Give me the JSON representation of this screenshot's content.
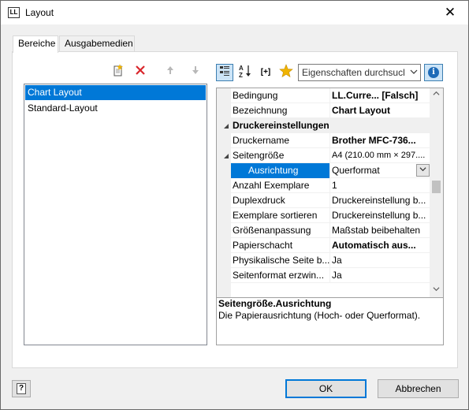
{
  "window": {
    "title": "Layout",
    "icon_text": "LL",
    "close_glyph": "✕"
  },
  "tabs": [
    {
      "label": "Bereiche",
      "active": true
    },
    {
      "label": "Ausgabemedien",
      "active": false
    }
  ],
  "left_toolbar": {
    "icons": [
      "new-item-icon",
      "delete-icon",
      "move-up-icon",
      "move-down-icon"
    ],
    "delete_color": "#d9262c"
  },
  "layout_list": [
    {
      "label": "Chart Layout",
      "selected": true
    },
    {
      "label": "Standard-Layout",
      "selected": false
    }
  ],
  "right_toolbar": {
    "icons": [
      "categorized-view-icon",
      "alphabetical-sort-icon",
      "expand-collapse-icon",
      "favorites-star-icon",
      "info-icon"
    ],
    "expand_label": "[+]",
    "search_placeholder": "Eigenschaften durchsuchen",
    "info_glyph": "i"
  },
  "properties": [
    {
      "name": "Bedingung",
      "value": "LL.Curre... [Falsch]",
      "bold": true,
      "type": "prop"
    },
    {
      "name": "Bezeichnung",
      "value": "Chart Layout",
      "bold": true,
      "type": "prop"
    },
    {
      "name": "Druckereinstellungen",
      "value": "",
      "bold": true,
      "type": "category"
    },
    {
      "name": "Druckername",
      "value": "Brother MFC-736...",
      "bold": true,
      "type": "prop"
    },
    {
      "name": "Seitengröße",
      "value": "A4 (210.00 mm × 297....",
      "bold": false,
      "type": "expandable"
    },
    {
      "name": "Ausrichtung",
      "value": "Querformat",
      "bold": false,
      "type": "selected"
    },
    {
      "name": "Anzahl Exemplare",
      "value": "1",
      "bold": false,
      "type": "prop"
    },
    {
      "name": "Duplexdruck",
      "value": "Druckereinstellung b...",
      "bold": false,
      "type": "prop"
    },
    {
      "name": "Exemplare sortieren",
      "value": "Druckereinstellung b...",
      "bold": false,
      "type": "prop"
    },
    {
      "name": "Größenanpassung",
      "value": "Maßstab beibehalten",
      "bold": false,
      "type": "prop"
    },
    {
      "name": "Papierschacht",
      "value": "Automatisch aus...",
      "bold": true,
      "type": "prop"
    },
    {
      "name": "Physikalische Seite b...",
      "value": "Ja",
      "bold": false,
      "type": "prop"
    },
    {
      "name": "Seitenformat erzwin...",
      "value": "Ja",
      "bold": false,
      "type": "prop"
    }
  ],
  "description": {
    "title": "Seitengröße.Ausrichtung",
    "text": "Die Papierausrichtung (Hoch- oder Querformat)."
  },
  "buttons": {
    "ok": "OK",
    "cancel": "Abbrechen",
    "help_glyph": "?"
  },
  "colors": {
    "selection": "#0078d7",
    "accent_border": "#3c7fb1",
    "info_blue": "#1e6bb8"
  }
}
